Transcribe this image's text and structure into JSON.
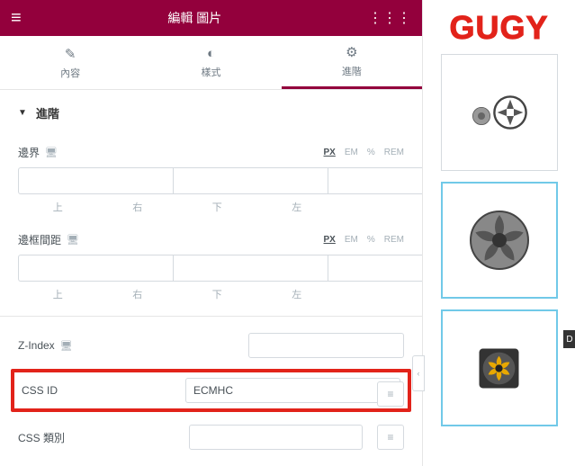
{
  "header": {
    "title": "編輯 圖片"
  },
  "tabs": {
    "content": "內容",
    "style": "樣式",
    "advanced": "進階"
  },
  "section": {
    "title": "進階"
  },
  "margin": {
    "label": "邊界",
    "units": {
      "px": "PX",
      "em": "EM",
      "pct": "%",
      "rem": "REM"
    },
    "sides": {
      "top": "上",
      "right": "右",
      "bottom": "下",
      "left": "左"
    }
  },
  "padding": {
    "label": "邊框間距",
    "units": {
      "px": "PX",
      "em": "EM",
      "pct": "%",
      "rem": "REM"
    },
    "sides": {
      "top": "上",
      "right": "右",
      "bottom": "下",
      "left": "左"
    }
  },
  "zindex": {
    "label": "Z-Index",
    "value": ""
  },
  "cssid": {
    "label": "CSS ID",
    "value": "ECMHC"
  },
  "cssclass": {
    "label": "CSS 類別",
    "value": ""
  },
  "logo": "GUGY",
  "collapse": "‹",
  "sidetag": "D"
}
